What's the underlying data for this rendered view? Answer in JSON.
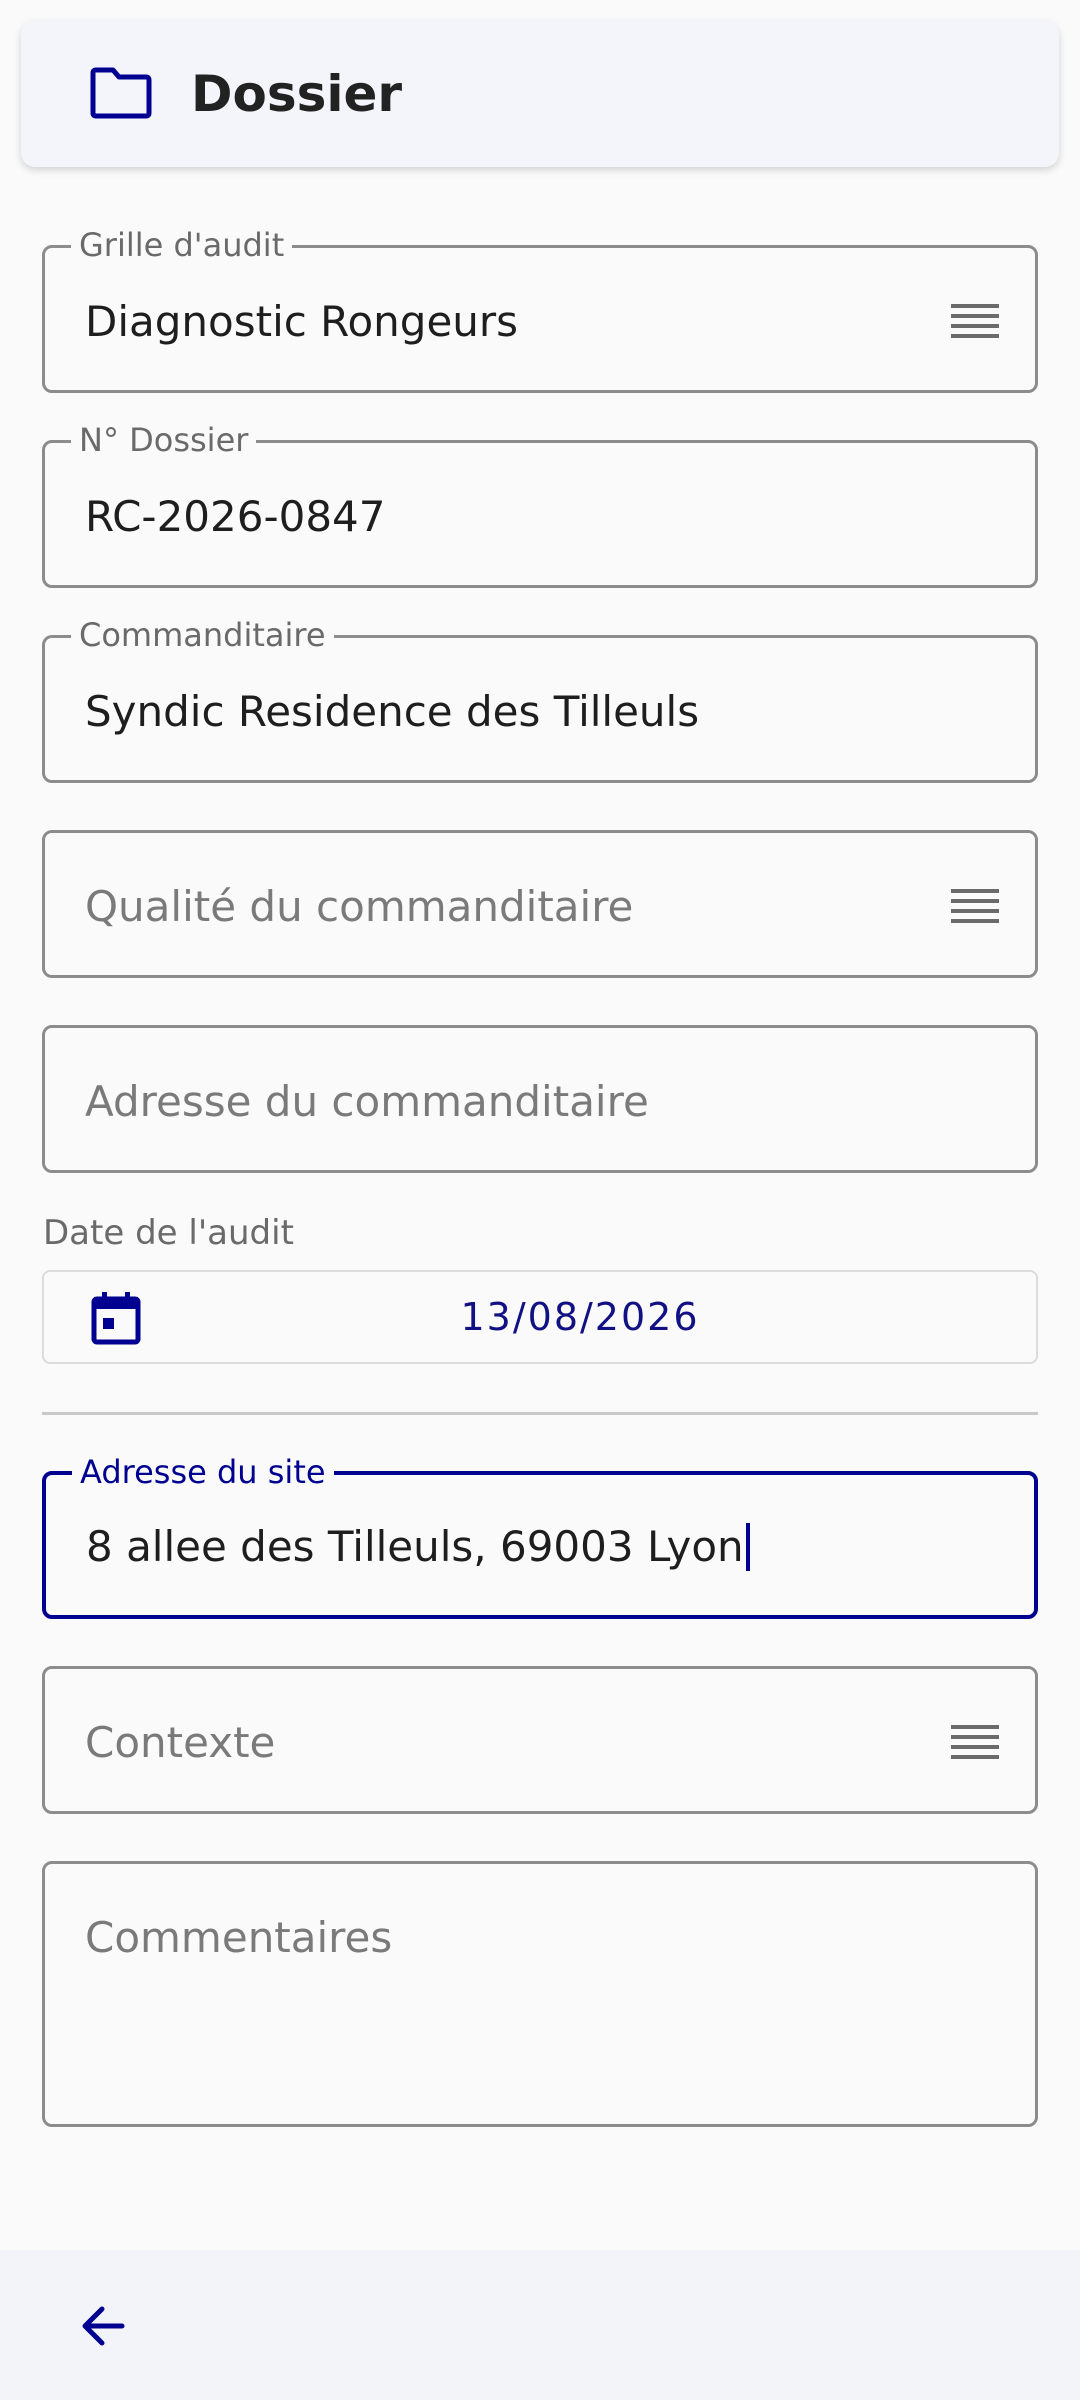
{
  "header": {
    "title": "Dossier",
    "icon": "folder-icon"
  },
  "form": {
    "grille": {
      "label": "Grille d'audit",
      "value": "Diagnostic Rongeurs"
    },
    "numero": {
      "label": "N° Dossier",
      "value": "RC-2026-0847"
    },
    "commanditaire": {
      "label": "Commanditaire",
      "value": "Syndic Residence des Tilleuls"
    },
    "qualite": {
      "placeholder": "Qualité du commanditaire"
    },
    "adresse_commanditaire": {
      "placeholder": "Adresse du commanditaire"
    },
    "date": {
      "label": "Date de l'audit",
      "value": "13/08/2026"
    },
    "adresse_site": {
      "label": "Adresse du site",
      "value": "8 allee des Tilleuls, 69003 Lyon"
    },
    "contexte": {
      "placeholder": "Contexte"
    },
    "commentaires": {
      "placeholder": "Commentaires"
    }
  },
  "colors": {
    "accent": "#000091",
    "border": "#8c8c8c",
    "placeholder": "#7a7a7a"
  },
  "nav": {
    "back_icon": "arrow-left-icon"
  }
}
